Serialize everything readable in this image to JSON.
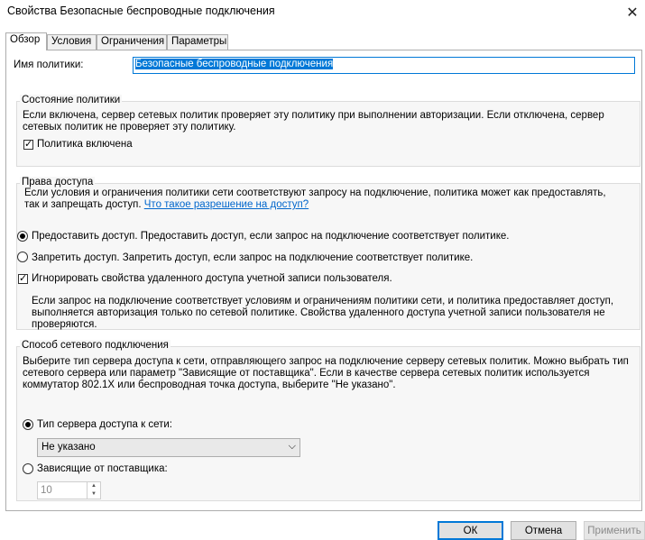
{
  "window": {
    "title": "Свойства Безопасные беспроводные подключения",
    "close_glyph": "✕"
  },
  "tabs": [
    {
      "label": "Обзор",
      "active": true
    },
    {
      "label": "Условия",
      "active": false
    },
    {
      "label": "Ограничения",
      "active": false
    },
    {
      "label": "Параметры",
      "active": false
    }
  ],
  "policy_name": {
    "label": "Имя политики:",
    "value": "Безопасные беспроводные подключения"
  },
  "policy_state": {
    "title": "Состояние политики",
    "description_line1": "Если включена, сервер сетевых политик проверяет эту политику при выполнении авторизации. Если отключена, сервер",
    "description_line2": "сетевых политик не проверяет эту политику.",
    "enabled_label": "Политика включена",
    "enabled": true
  },
  "access": {
    "title": "Права доступа",
    "description_line1": "Если условия и ограничения политики сети соответствуют запросу на подключение, политика может как предоставлять,",
    "description_line2": "так и запрещать доступ.",
    "link": "Что такое разрешение на доступ?",
    "grant_label": "Предоставить доступ. Предоставить доступ, если запрос на подключение соответствует политике.",
    "deny_label": "Запретить доступ. Запретить доступ, если запрос на подключение соответствует политике.",
    "ignore_label": "Игнорировать свойства удаленного доступа учетной записи пользователя.",
    "ignore_desc_line1": "Если запрос на подключение соответствует условиям и ограничениям политики сети, и политика предоставляет доступ,",
    "ignore_desc_line2": "выполняется авторизация только по сетевой политике. Свойства удаленного доступа учетной записи пользователя не",
    "ignore_desc_line3": "проверяются."
  },
  "connection_method": {
    "title": "Способ сетевого подключения",
    "description_line1": "Выберите тип сервера доступа к сети, отправляющего запрос на подключение серверу сетевых политик. Можно выбрать тип",
    "description_line2": "сетевого сервера или параметр \"Зависящие от поставщика\". Если в качестве сервера сетевых политик используется",
    "description_line3": "коммутатор 802.1X или беспроводная точка доступа, выберите \"Не указано\".",
    "server_type_label": "Тип сервера доступа к сети:",
    "server_type_value": "Не указано",
    "vendor_label": "Зависящие от поставщика:",
    "vendor_value": "10"
  },
  "buttons": {
    "ok": "ОК",
    "cancel": "Отмена",
    "apply": "Применить"
  }
}
